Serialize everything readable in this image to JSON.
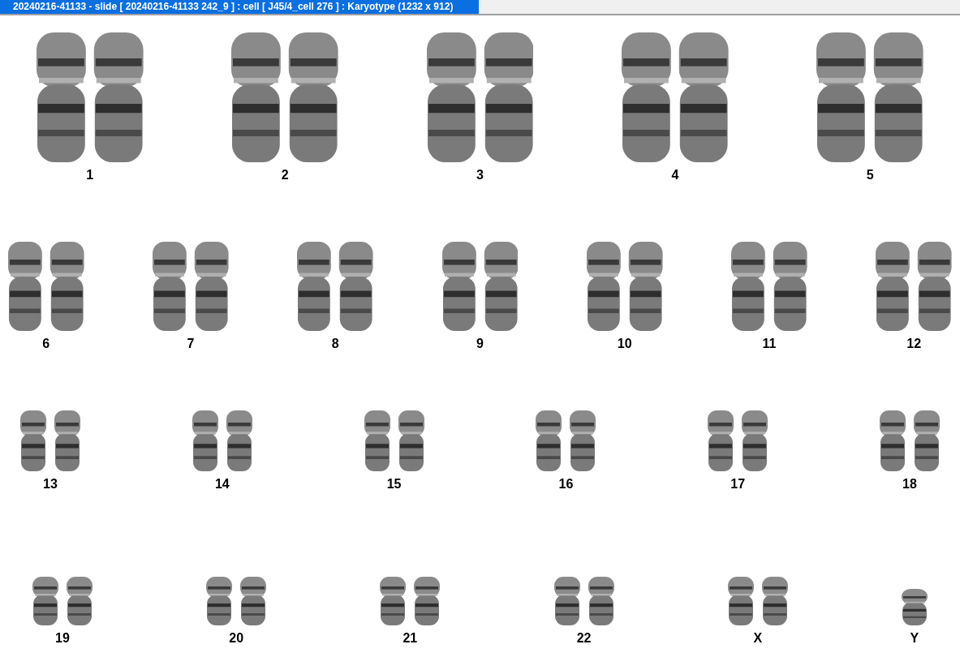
{
  "window": {
    "title": "20240216-41133 - slide [ 20240216-41133 242_9 ] : cell [ J45/4_cell 276 ] : Karyotype  (1232 x 912)"
  },
  "karyotype": {
    "rows": [
      {
        "items": [
          {
            "label": "1",
            "kind": "pair"
          },
          {
            "label": "2",
            "kind": "pair"
          },
          {
            "label": "3",
            "kind": "pair"
          },
          {
            "label": "4",
            "kind": "pair"
          },
          {
            "label": "5",
            "kind": "pair"
          }
        ]
      },
      {
        "items": [
          {
            "label": "6",
            "kind": "pair"
          },
          {
            "label": "7",
            "kind": "pair"
          },
          {
            "label": "8",
            "kind": "pair"
          },
          {
            "label": "9",
            "kind": "pair"
          },
          {
            "label": "10",
            "kind": "pair"
          },
          {
            "label": "11",
            "kind": "pair"
          },
          {
            "label": "12",
            "kind": "pair"
          }
        ]
      },
      {
        "items": [
          {
            "label": "13",
            "kind": "pair"
          },
          {
            "label": "14",
            "kind": "pair"
          },
          {
            "label": "15",
            "kind": "pair"
          },
          {
            "label": "16",
            "kind": "pair"
          },
          {
            "label": "17",
            "kind": "pair"
          },
          {
            "label": "18",
            "kind": "pair"
          }
        ]
      },
      {
        "items": [
          {
            "label": "19",
            "kind": "pair"
          },
          {
            "label": "20",
            "kind": "pair"
          },
          {
            "label": "21",
            "kind": "pair"
          },
          {
            "label": "22",
            "kind": "pair"
          },
          {
            "label": "X",
            "kind": "pair"
          },
          {
            "label": "Y",
            "kind": "single"
          }
        ]
      }
    ]
  }
}
